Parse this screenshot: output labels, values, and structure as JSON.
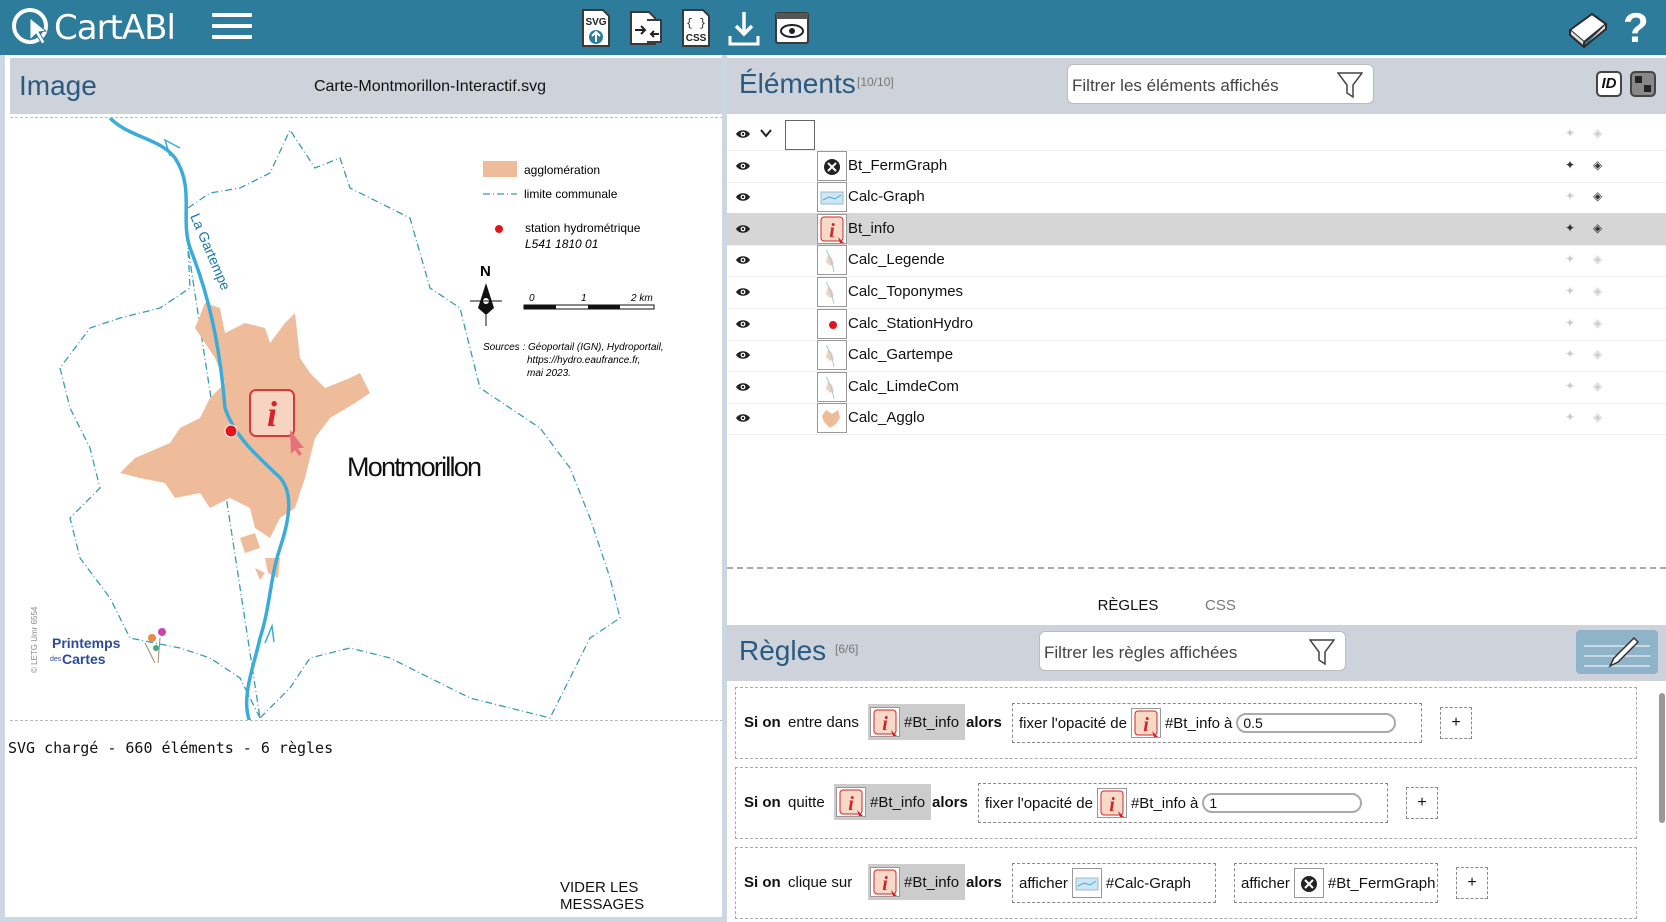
{
  "app": {
    "name": "CartABl"
  },
  "colors": {
    "topbar": "#2e7c9b",
    "panel_header": "#cdd2db",
    "agglo": "#eebc9b",
    "river": "#3aacd9",
    "station": "#e0161c",
    "info_red": "#d6232a",
    "edit_btn": "#8fb3c9"
  },
  "toolbar": {
    "items": [
      {
        "name": "load-svg-button",
        "icon": "svg-upload-icon",
        "label": "SVG"
      },
      {
        "name": "import-button",
        "icon": "import-icon"
      },
      {
        "name": "css-button",
        "icon": "css-icon",
        "label": "CSS"
      },
      {
        "name": "download-button",
        "icon": "download-icon"
      },
      {
        "name": "preview-button",
        "icon": "eye-icon"
      }
    ],
    "right": [
      {
        "name": "book-button",
        "icon": "book-icon"
      },
      {
        "name": "help-button",
        "icon": "help-icon",
        "label": "?"
      }
    ]
  },
  "image_panel": {
    "title": "Image",
    "filename": "Carte-Montmorillon-Interactif.svg",
    "message": "SVG chargé - 660 éléments - 6 règles",
    "clear_label": "VIDER LES MESSAGES",
    "map": {
      "legend": [
        "agglomération",
        "limite communale",
        "station hydrométrique",
        "L541 1810 01"
      ],
      "north": "N",
      "scale": [
        "0",
        "1",
        "2 km"
      ],
      "sources": [
        "Sources : Géoportail (IGN), Hydroportail,",
        "https://hydro.eaufrance.fr,",
        "mai 2023."
      ],
      "river_label": "La Gartempe",
      "city_label": "Montmorillon",
      "credit": "© LETG Umr 6554",
      "logo": [
        "Printemps",
        "des",
        "Cartes"
      ],
      "info_glyph": "i"
    }
  },
  "elements_panel": {
    "title": "Éléments",
    "count": "[10/10]",
    "filter_placeholder": "Filtrer les éléments affichés",
    "id_label": "ID",
    "rows": [
      {
        "label": "",
        "thumb": "empty"
      },
      {
        "label": "Bt_FermGraph",
        "thumb": "close"
      },
      {
        "label": "Calc-Graph",
        "thumb": "graph"
      },
      {
        "label": "Bt_info",
        "thumb": "info",
        "selected": true
      },
      {
        "label": "Calc_Legende",
        "thumb": "map"
      },
      {
        "label": "Calc_Toponymes",
        "thumb": "map"
      },
      {
        "label": "Calc_StationHydro",
        "thumb": "dot"
      },
      {
        "label": "Calc_Gartempe",
        "thumb": "map"
      },
      {
        "label": "Calc_LimdeCom",
        "thumb": "map"
      },
      {
        "label": "Calc_Agglo",
        "thumb": "agglo"
      }
    ]
  },
  "tabs": {
    "rules": "RÈGLES",
    "css": "CSS"
  },
  "rules_panel": {
    "title": "Règles",
    "count": "[6/6]",
    "filter_placeholder": "Filtrer les règles affichées",
    "si": "Si on",
    "alors": "alors",
    "plus": "+",
    "rules": [
      {
        "event": "entre dans",
        "target": "#Bt_info",
        "actions": [
          {
            "text": "fixer l'opacité de",
            "target": "#Bt_info",
            "suffix": "à",
            "value": "0.5"
          }
        ]
      },
      {
        "event": "quitte",
        "target": "#Bt_info",
        "actions": [
          {
            "text": "fixer l'opacité de",
            "target": "#Bt_info",
            "suffix": "à",
            "value": "1"
          }
        ]
      },
      {
        "event": "clique sur",
        "target": "#Bt_info",
        "actions": [
          {
            "text": "afficher",
            "target": "#Calc-Graph"
          },
          {
            "text": "afficher",
            "target": "#Bt_FermGraph"
          }
        ]
      }
    ]
  }
}
